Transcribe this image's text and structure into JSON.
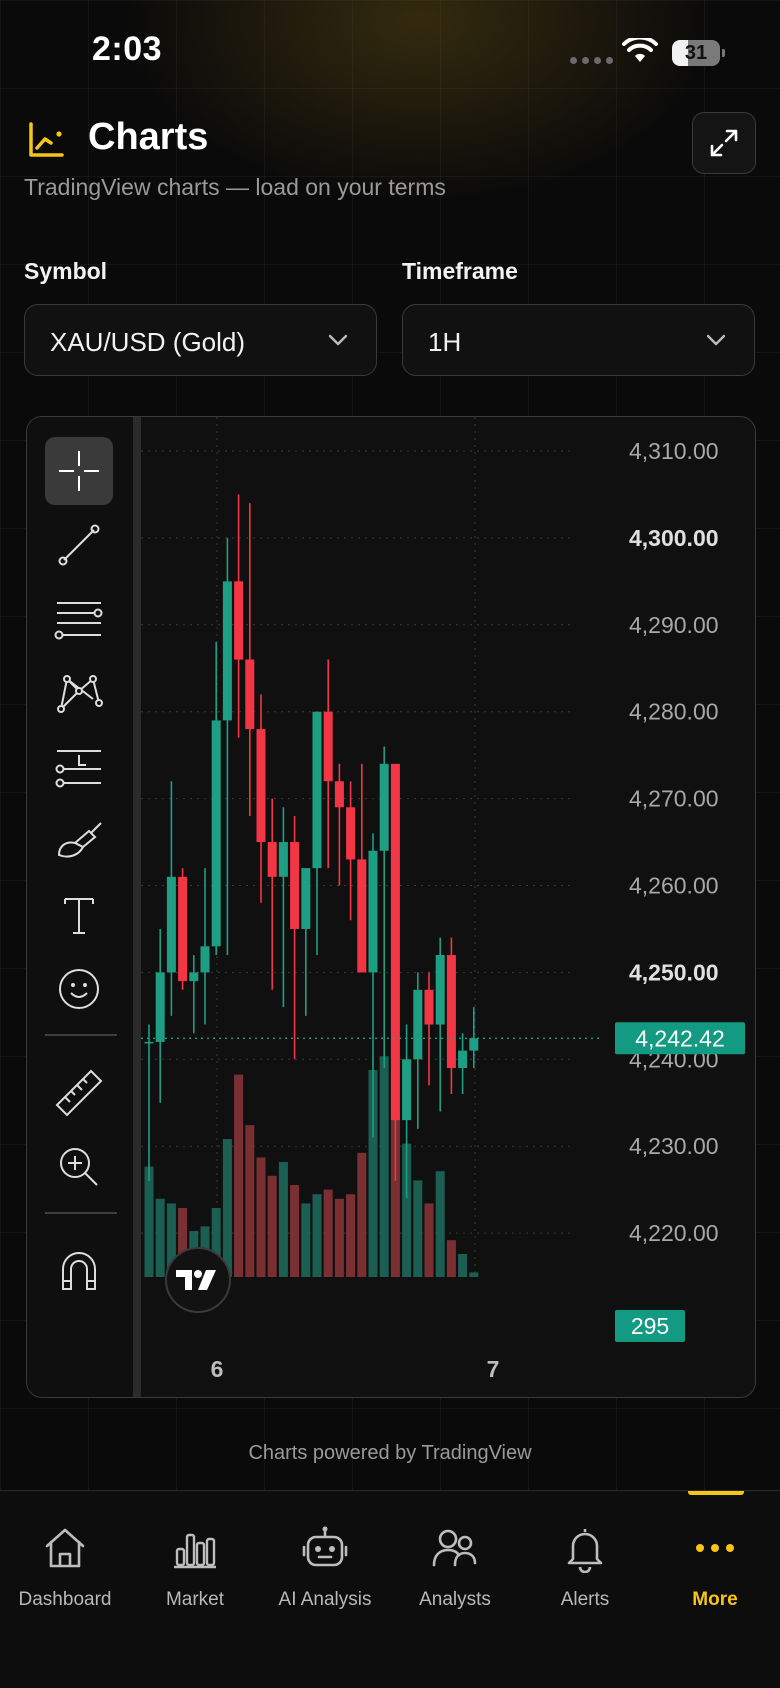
{
  "status_bar": {
    "time": "2:03",
    "battery": "31"
  },
  "header": {
    "title": "Charts",
    "subtitle": "TradingView charts — load on your terms",
    "icon": "chart-line-icon",
    "expand_icon": "expand-icon"
  },
  "controls": {
    "symbol_label": "Symbol",
    "symbol_value": "XAU/USD (Gold)",
    "timeframe_label": "Timeframe",
    "timeframe_value": "1H"
  },
  "toolbar": {
    "tools": [
      "crosshair-icon",
      "trend-line-icon",
      "fib-retracement-icon",
      "pattern-icon",
      "long-position-icon",
      "brush-icon",
      "text-icon",
      "emoji-icon"
    ],
    "tools_secondary": [
      "ruler-icon",
      "zoom-in-icon"
    ],
    "tools_tertiary": [
      "magnet-icon"
    ]
  },
  "colors": {
    "up": "#1e9e82",
    "down": "#f23645",
    "accent": "#f5c518",
    "last_price_bg": "#139a83",
    "volume_label_bg": "#139a83"
  },
  "chart_data": {
    "type": "candlestick",
    "symbol": "XAU/USD",
    "price_axis_ticks": [
      "4,310.00",
      "4,300.00",
      "4,290.00",
      "4,280.00",
      "4,270.00",
      "4,260.00",
      "4,250.00",
      "4,240.00",
      "4,230.00",
      "4,220.00"
    ],
    "price_tick_values": [
      4310,
      4300,
      4290,
      4280,
      4270,
      4260,
      4250,
      4240,
      4230,
      4220
    ],
    "bold_ticks": [
      "4,300.00",
      "4,250.00"
    ],
    "ylim": [
      4215,
      4312
    ],
    "x_ticks": [
      "6",
      "7"
    ],
    "last_price": "4,242.42",
    "last_price_value": 4242.42,
    "volume_label": "295",
    "candles": [
      {
        "o": 4242,
        "h": 4244,
        "l": 4226,
        "c": 4242
      },
      {
        "o": 4242,
        "h": 4255,
        "l": 4235,
        "c": 4250
      },
      {
        "o": 4250,
        "h": 4272,
        "l": 4245,
        "c": 4261
      },
      {
        "o": 4261,
        "h": 4262,
        "l": 4248,
        "c": 4249
      },
      {
        "o": 4249,
        "h": 4252,
        "l": 4243,
        "c": 4250
      },
      {
        "o": 4250,
        "h": 4262,
        "l": 4244,
        "c": 4253
      },
      {
        "o": 4253,
        "h": 4288,
        "l": 4252,
        "c": 4279
      },
      {
        "o": 4279,
        "h": 4300,
        "l": 4252,
        "c": 4295
      },
      {
        "o": 4295,
        "h": 4305,
        "l": 4277,
        "c": 4286
      },
      {
        "o": 4286,
        "h": 4304,
        "l": 4268,
        "c": 4278
      },
      {
        "o": 4278,
        "h": 4282,
        "l": 4258,
        "c": 4265
      },
      {
        "o": 4265,
        "h": 4270,
        "l": 4248,
        "c": 4261
      },
      {
        "o": 4261,
        "h": 4269,
        "l": 4246,
        "c": 4265
      },
      {
        "o": 4265,
        "h": 4268,
        "l": 4240,
        "c": 4255
      },
      {
        "o": 4255,
        "h": 4260,
        "l": 4245,
        "c": 4262
      },
      {
        "o": 4262,
        "h": 4280,
        "l": 4252,
        "c": 4280
      },
      {
        "o": 4280,
        "h": 4286,
        "l": 4262,
        "c": 4272
      },
      {
        "o": 4272,
        "h": 4274,
        "l": 4260,
        "c": 4269
      },
      {
        "o": 4269,
        "h": 4272,
        "l": 4256,
        "c": 4263
      },
      {
        "o": 4263,
        "h": 4274,
        "l": 4250,
        "c": 4250
      },
      {
        "o": 4250,
        "h": 4266,
        "l": 4231,
        "c": 4264
      },
      {
        "o": 4264,
        "h": 4276,
        "l": 4239,
        "c": 4274
      },
      {
        "o": 4274,
        "h": 4274,
        "l": 4226,
        "c": 4233
      },
      {
        "o": 4233,
        "h": 4244,
        "l": 4224,
        "c": 4240
      },
      {
        "o": 4240,
        "h": 4250,
        "l": 4232,
        "c": 4248
      },
      {
        "o": 4248,
        "h": 4250,
        "l": 4237,
        "c": 4244
      },
      {
        "o": 4244,
        "h": 4254,
        "l": 4234,
        "c": 4252
      },
      {
        "o": 4252,
        "h": 4254,
        "l": 4236,
        "c": 4239
      },
      {
        "o": 4239,
        "h": 4243,
        "l": 4236,
        "c": 4241
      },
      {
        "o": 4241,
        "h": 4246,
        "l": 4239,
        "c": 4242.42
      }
    ],
    "volumes": [
      48,
      34,
      32,
      30,
      20,
      22,
      30,
      60,
      88,
      66,
      52,
      44,
      50,
      40,
      32,
      36,
      38,
      34,
      36,
      54,
      90,
      96,
      72,
      58,
      42,
      32,
      46,
      16,
      10,
      2
    ]
  },
  "footer": {
    "powered_by": "Charts powered by TradingView"
  },
  "nav": {
    "items": [
      {
        "label": "Dashboard",
        "icon": "home-icon"
      },
      {
        "label": "Market",
        "icon": "bar-chart-icon"
      },
      {
        "label": "AI Analysis",
        "icon": "robot-icon"
      },
      {
        "label": "Analysts",
        "icon": "users-icon"
      },
      {
        "label": "Alerts",
        "icon": "bell-icon"
      },
      {
        "label": "More",
        "icon": "more-dots-icon"
      }
    ],
    "active": "More"
  }
}
